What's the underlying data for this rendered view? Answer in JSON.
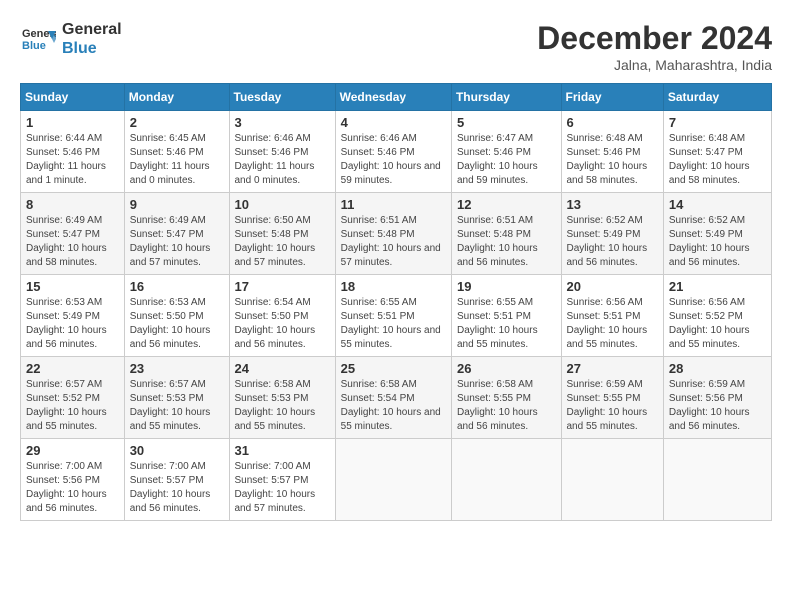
{
  "header": {
    "logo_line1": "General",
    "logo_line2": "Blue",
    "month": "December 2024",
    "location": "Jalna, Maharashtra, India"
  },
  "days_of_week": [
    "Sunday",
    "Monday",
    "Tuesday",
    "Wednesday",
    "Thursday",
    "Friday",
    "Saturday"
  ],
  "weeks": [
    [
      {
        "day": "1",
        "sunrise": "6:44 AM",
        "sunset": "5:46 PM",
        "daylight": "11 hours and 1 minute."
      },
      {
        "day": "2",
        "sunrise": "6:45 AM",
        "sunset": "5:46 PM",
        "daylight": "11 hours and 0 minutes."
      },
      {
        "day": "3",
        "sunrise": "6:46 AM",
        "sunset": "5:46 PM",
        "daylight": "11 hours and 0 minutes."
      },
      {
        "day": "4",
        "sunrise": "6:46 AM",
        "sunset": "5:46 PM",
        "daylight": "10 hours and 59 minutes."
      },
      {
        "day": "5",
        "sunrise": "6:47 AM",
        "sunset": "5:46 PM",
        "daylight": "10 hours and 59 minutes."
      },
      {
        "day": "6",
        "sunrise": "6:48 AM",
        "sunset": "5:46 PM",
        "daylight": "10 hours and 58 minutes."
      },
      {
        "day": "7",
        "sunrise": "6:48 AM",
        "sunset": "5:47 PM",
        "daylight": "10 hours and 58 minutes."
      }
    ],
    [
      {
        "day": "8",
        "sunrise": "6:49 AM",
        "sunset": "5:47 PM",
        "daylight": "10 hours and 58 minutes."
      },
      {
        "day": "9",
        "sunrise": "6:49 AM",
        "sunset": "5:47 PM",
        "daylight": "10 hours and 57 minutes."
      },
      {
        "day": "10",
        "sunrise": "6:50 AM",
        "sunset": "5:48 PM",
        "daylight": "10 hours and 57 minutes."
      },
      {
        "day": "11",
        "sunrise": "6:51 AM",
        "sunset": "5:48 PM",
        "daylight": "10 hours and 57 minutes."
      },
      {
        "day": "12",
        "sunrise": "6:51 AM",
        "sunset": "5:48 PM",
        "daylight": "10 hours and 56 minutes."
      },
      {
        "day": "13",
        "sunrise": "6:52 AM",
        "sunset": "5:49 PM",
        "daylight": "10 hours and 56 minutes."
      },
      {
        "day": "14",
        "sunrise": "6:52 AM",
        "sunset": "5:49 PM",
        "daylight": "10 hours and 56 minutes."
      }
    ],
    [
      {
        "day": "15",
        "sunrise": "6:53 AM",
        "sunset": "5:49 PM",
        "daylight": "10 hours and 56 minutes."
      },
      {
        "day": "16",
        "sunrise": "6:53 AM",
        "sunset": "5:50 PM",
        "daylight": "10 hours and 56 minutes."
      },
      {
        "day": "17",
        "sunrise": "6:54 AM",
        "sunset": "5:50 PM",
        "daylight": "10 hours and 56 minutes."
      },
      {
        "day": "18",
        "sunrise": "6:55 AM",
        "sunset": "5:51 PM",
        "daylight": "10 hours and 55 minutes."
      },
      {
        "day": "19",
        "sunrise": "6:55 AM",
        "sunset": "5:51 PM",
        "daylight": "10 hours and 55 minutes."
      },
      {
        "day": "20",
        "sunrise": "6:56 AM",
        "sunset": "5:51 PM",
        "daylight": "10 hours and 55 minutes."
      },
      {
        "day": "21",
        "sunrise": "6:56 AM",
        "sunset": "5:52 PM",
        "daylight": "10 hours and 55 minutes."
      }
    ],
    [
      {
        "day": "22",
        "sunrise": "6:57 AM",
        "sunset": "5:52 PM",
        "daylight": "10 hours and 55 minutes."
      },
      {
        "day": "23",
        "sunrise": "6:57 AM",
        "sunset": "5:53 PM",
        "daylight": "10 hours and 55 minutes."
      },
      {
        "day": "24",
        "sunrise": "6:58 AM",
        "sunset": "5:53 PM",
        "daylight": "10 hours and 55 minutes."
      },
      {
        "day": "25",
        "sunrise": "6:58 AM",
        "sunset": "5:54 PM",
        "daylight": "10 hours and 55 minutes."
      },
      {
        "day": "26",
        "sunrise": "6:58 AM",
        "sunset": "5:55 PM",
        "daylight": "10 hours and 56 minutes."
      },
      {
        "day": "27",
        "sunrise": "6:59 AM",
        "sunset": "5:55 PM",
        "daylight": "10 hours and 55 minutes."
      },
      {
        "day": "28",
        "sunrise": "6:59 AM",
        "sunset": "5:56 PM",
        "daylight": "10 hours and 56 minutes."
      }
    ],
    [
      {
        "day": "29",
        "sunrise": "7:00 AM",
        "sunset": "5:56 PM",
        "daylight": "10 hours and 56 minutes."
      },
      {
        "day": "30",
        "sunrise": "7:00 AM",
        "sunset": "5:57 PM",
        "daylight": "10 hours and 56 minutes."
      },
      {
        "day": "31",
        "sunrise": "7:00 AM",
        "sunset": "5:57 PM",
        "daylight": "10 hours and 57 minutes."
      },
      null,
      null,
      null,
      null
    ]
  ]
}
